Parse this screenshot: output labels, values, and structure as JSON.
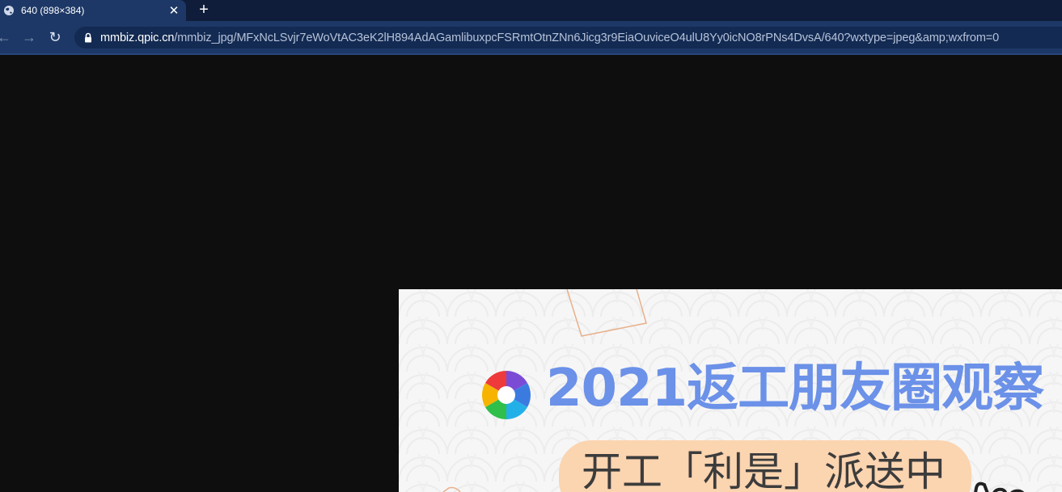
{
  "tab": {
    "title": "640 (898×384)",
    "favicon": "globe-icon",
    "close_glyph": "✕"
  },
  "new_tab_glyph": "+",
  "toolbar": {
    "back": "←",
    "forward": "→",
    "reload": "↻",
    "url_host": "mmbiz.qpic.cn",
    "url_path": "/mmbiz_jpg/MFxNcLSvjr7eWoVtAC3eK2lH894AdAGamlibuxpcFSRmtOtnZNn6Jicg3r9EiaOuviceO4ulU8Yy0icNO8rPNs4DvsA/640?wxtype=jpeg&amp;wxfrom=0"
  },
  "image": {
    "headline": "2021返工朋友圈观察",
    "subline": "开工「利是」派送中",
    "accent": "#6b91e8",
    "pill_color": "#fbd4b0"
  }
}
